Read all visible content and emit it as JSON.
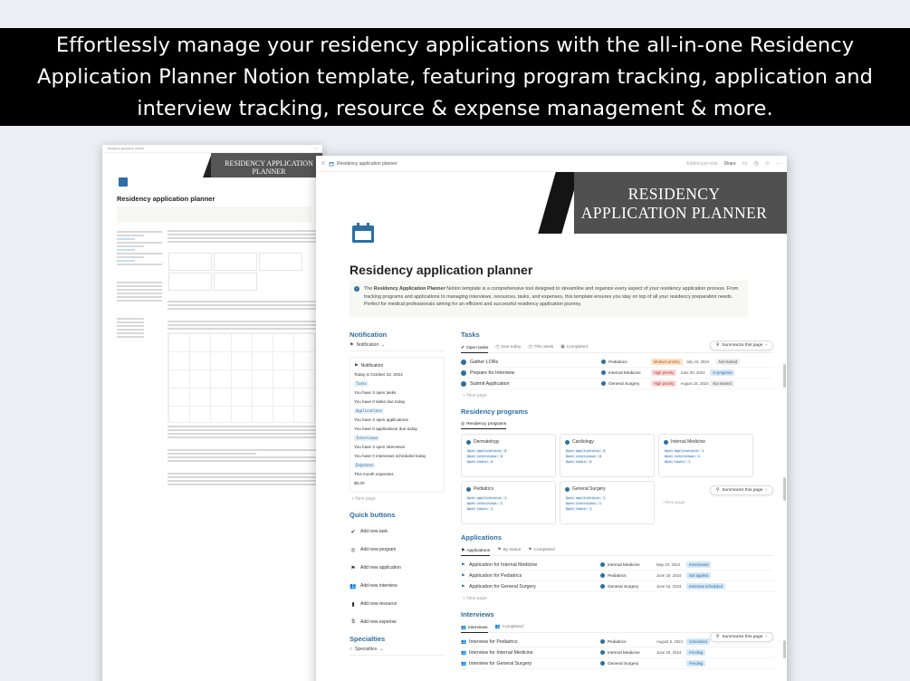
{
  "banner": {
    "text": "Effortlessly manage your residency applications with the all-in-one Residency Application Planner Notion template, featuring program tracking, application and interview tracking, resource & expense management & more."
  },
  "colors": {
    "accent": "#2d6ea3",
    "banner_bg": "#000000",
    "cover_bg": "#505050"
  },
  "back_window": {
    "breadcrumb": "Residency application planner",
    "cover_text": "RESIDENCY APPLICATION PLANNER",
    "title": "Residency application planner"
  },
  "front_window": {
    "breadcrumb": "Residency application planner",
    "edited": "Edited just now",
    "share": "Share",
    "cover_line1": "RESIDENCY",
    "cover_line2": "APPLICATION PLANNER",
    "page_title": "Residency application planner",
    "callout": {
      "pre": "The ",
      "bold": "Residency Application Planner",
      "rest": " Notion template is a comprehensive tool designed to streamline and organize every aspect of your residency application process. From tracking programs and applications to managing interviews, resources, tasks, and expenses, this template ensures you stay on top of all your residency preparation needs. Perfect for medical professionals aiming for an efficient and successful residency application journey."
    },
    "notification": {
      "heading": "Notification",
      "view": "Notification",
      "card_title": "Notification",
      "lines": [
        {
          "text": "Today is October 22, 2024"
        },
        {
          "chip": "Tasks"
        },
        {
          "text": "You have 3 open tasks"
        },
        {
          "text": "You have 0 tasks due today"
        },
        {
          "chip": "Applications"
        },
        {
          "text": "You have 3 open applications"
        },
        {
          "text": "You have 0 applications due today"
        },
        {
          "chip": "Interviews"
        },
        {
          "text": "You have 3 open interviews"
        },
        {
          "text": "You have 0 interviews scheduled today"
        },
        {
          "chip": "Expenses"
        },
        {
          "text": "This month expenses"
        },
        {
          "text": "$0.00"
        }
      ],
      "new_page": "New page"
    },
    "quick_buttons": {
      "heading": "Quick buttons",
      "items": [
        {
          "label": "Add new task",
          "icon": "check-circle-icon"
        },
        {
          "label": "Add new program",
          "icon": "target-icon"
        },
        {
          "label": "Add new application",
          "icon": "flag-icon"
        },
        {
          "label": "Add new interview",
          "icon": "people-icon"
        },
        {
          "label": "Add new resource",
          "icon": "bookmark-icon"
        },
        {
          "label": "Add new expense",
          "icon": "dollar-icon"
        }
      ]
    },
    "specialties": {
      "heading": "Specialties",
      "view": "Specialties"
    },
    "tasks": {
      "heading": "Tasks",
      "tabs": [
        "Open tasks",
        "Due today",
        "This week",
        "Completed"
      ],
      "summarize": "Summarize this page",
      "rows": [
        {
          "name": "Gather LORs",
          "program": "Pediatrics",
          "priority": "Medium priority",
          "priority_color": "orange",
          "date": "July 10, 2024",
          "status": "Not started",
          "status_color": "gray"
        },
        {
          "name": "Prepare for Interview",
          "program": "Internal Medicine",
          "priority": "High priority",
          "priority_color": "red",
          "date": "June 20, 2024",
          "status": "In progress",
          "status_color": "blue"
        },
        {
          "name": "Submit Application",
          "program": "General Surgery",
          "priority": "High priority",
          "priority_color": "red",
          "date": "August 15, 2024",
          "status": "Not started",
          "status_color": "gray"
        }
      ],
      "new_page": "New page"
    },
    "programs": {
      "heading": "Residency programs",
      "view": "Residency programs",
      "cards": [
        {
          "name": "Dermatology",
          "apps": "Open applications: 0",
          "ints": "Open interviews: 0",
          "tasks": "Open tasks: 0"
        },
        {
          "name": "Cardiology",
          "apps": "Open applications: 0",
          "ints": "Open interviews: 0",
          "tasks": "Open tasks: 0"
        },
        {
          "name": "Internal Medicine",
          "apps": "Open applications: 1",
          "ints": "Open interviews: 1",
          "tasks": "Open tasks: 1"
        },
        {
          "name": "Pediatrics",
          "apps": "Open applications: 1",
          "ints": "Open interviews: 1",
          "tasks": "Open tasks: 1"
        },
        {
          "name": "General Surgery",
          "apps": "Open applications: 1",
          "ints": "Open interviews: 1",
          "tasks": "Open tasks: 1"
        }
      ],
      "new_page": "New page",
      "summarize": "Summarize this page"
    },
    "applications": {
      "heading": "Applications",
      "tabs": [
        "Applications",
        "By status",
        "Completed"
      ],
      "rows": [
        {
          "name": "Application for Internal Medicine",
          "program": "Internal Medicine",
          "date": "May 20, 2024",
          "status": "Interviewed"
        },
        {
          "name": "Application for Pediatrics",
          "program": "Pediatrics",
          "date": "June 20, 2024",
          "status": "Not applied"
        },
        {
          "name": "Application for General Surgery",
          "program": "General Surgery",
          "date": "June 15, 2024",
          "status": "Interview scheduled"
        }
      ],
      "new_page": "New page"
    },
    "interviews": {
      "heading": "Interviews",
      "tabs": [
        "Interviews",
        "Completed"
      ],
      "rows": [
        {
          "name": "Interview for Pediatrics",
          "program": "Pediatrics",
          "date": "August 5, 2024",
          "status": "Scheduled"
        },
        {
          "name": "Interview for Internal Medicine",
          "program": "Internal Medicine",
          "date": "June 20, 2024",
          "status": "Pending"
        },
        {
          "name": "Interview for General Surgery",
          "program": "General Surgery",
          "date": "",
          "status": "Pending"
        }
      ],
      "summarize": "Summarize this page"
    }
  }
}
